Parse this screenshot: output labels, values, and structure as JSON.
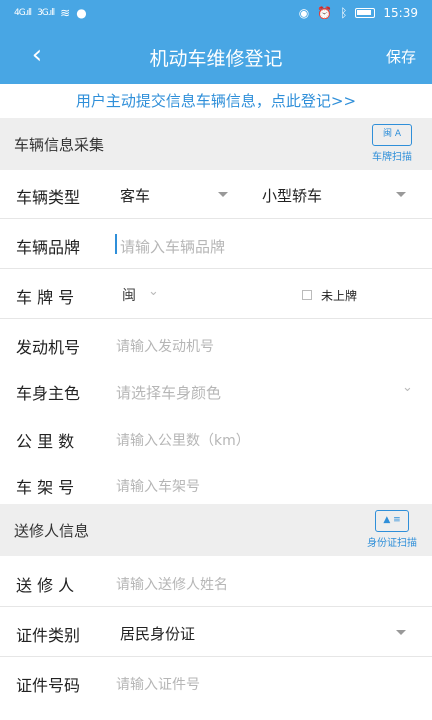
{
  "status_bar": {
    "signal_1": "4G.ıll",
    "signal_2": "3G.ıll",
    "time": "15:39"
  },
  "header": {
    "back_icon": "‹",
    "title": "机动车维修登记",
    "save_label": "保存"
  },
  "banner": {
    "text": "用户主动提交信息车辆信息，点此登记>>"
  },
  "vehicle_section": {
    "title": "车辆信息采集",
    "scan_label": "车牌扫描",
    "scan_icon_text": "闽 A",
    "fields": {
      "type": {
        "label": "车辆类型",
        "value_1": "客车",
        "value_2": "小型轿车"
      },
      "brand": {
        "label": "车辆品牌",
        "placeholder": "请输入车辆品牌"
      },
      "plate": {
        "label": "车 牌 号",
        "prefix": "闽",
        "no_plate_label": "未上牌"
      },
      "engine": {
        "label": "发动机号",
        "placeholder": "请输入发动机号"
      },
      "color": {
        "label": "车身主色",
        "placeholder": "请选择车身颜色"
      },
      "mileage": {
        "label": "公 里 数",
        "placeholder": "请输入公里数（km）"
      },
      "vin": {
        "label": "车 架 号",
        "placeholder": "请输入车架号"
      }
    }
  },
  "owner_section": {
    "title": "送修人信息",
    "scan_label": "身份证扫描",
    "fields": {
      "name": {
        "label": "送 修 人",
        "placeholder": "请输入送修人姓名"
      },
      "id_type": {
        "label": "证件类别",
        "value": "居民身份证"
      },
      "id_number": {
        "label": "证件号码",
        "placeholder": "请输入证件号"
      }
    }
  },
  "colors": {
    "primary": "#48a6e4",
    "link": "#2f8fd9",
    "section_bg": "#eeeeee"
  }
}
